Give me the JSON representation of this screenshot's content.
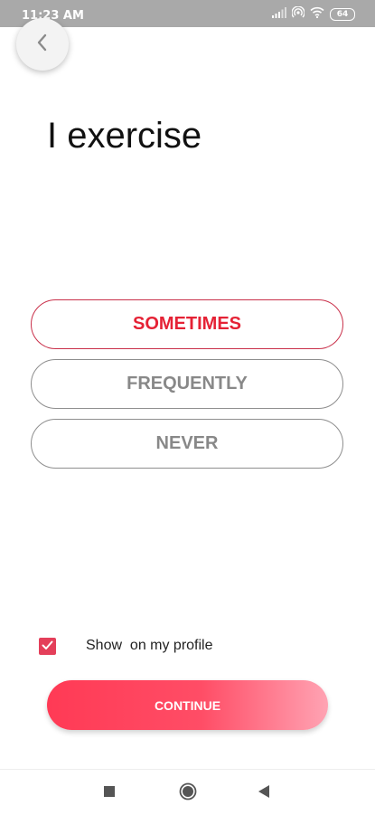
{
  "status_bar": {
    "time": "11:23 AM",
    "battery": "64",
    "icons": [
      "signal-icon",
      "hotspot-icon",
      "wifi-icon",
      "battery-icon"
    ]
  },
  "header": {
    "back_icon": "chevron-left-icon"
  },
  "question": {
    "title": "I exercise"
  },
  "options": [
    {
      "label": "SOMETIMES",
      "selected": true
    },
    {
      "label": "FREQUENTLY",
      "selected": false
    },
    {
      "label": "NEVER",
      "selected": false
    }
  ],
  "profile_toggle": {
    "label": "Show  on my profile",
    "checked": true
  },
  "continue_button": {
    "label": "CONTINUE"
  },
  "nav_bar": {
    "icons": [
      "recent-apps-icon",
      "home-icon",
      "back-icon"
    ]
  },
  "colors": {
    "accent": "#e52235",
    "checkbox": "#e43f5a",
    "button_gradient_start": "#ff3a55",
    "button_gradient_end": "#ffa3b3"
  }
}
